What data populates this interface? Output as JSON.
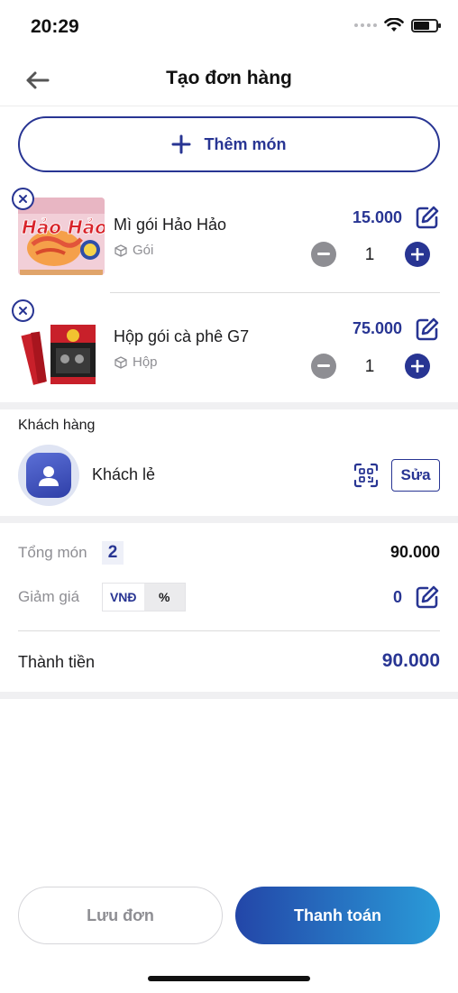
{
  "status_bar": {
    "time": "20:29"
  },
  "header": {
    "title": "Tạo đơn hàng"
  },
  "add_item": {
    "label": "Thêm món"
  },
  "items": [
    {
      "name": "Mì gói Hảo Hảo",
      "unit": "Gói",
      "price": "15.000",
      "quantity": "1",
      "image_text": "Hảo Hảo"
    },
    {
      "name": "Hộp gói cà phê G7",
      "unit": "Hộp",
      "price": "75.000",
      "quantity": "1"
    }
  ],
  "customer": {
    "section_title": "Khách hàng",
    "name": "Khách lẻ",
    "edit_label": "Sửa"
  },
  "summary": {
    "item_count_label": "Tổng món",
    "item_count": "2",
    "item_total": "90.000",
    "discount_label": "Giảm giá",
    "discount_options": [
      "VNĐ",
      "%"
    ],
    "discount_selected": "VNĐ",
    "discount_value": "0",
    "total_label": "Thành tiền",
    "total_value": "90.000"
  },
  "actions": {
    "save_label": "Lưu đơn",
    "pay_label": "Thanh toán"
  },
  "colors": {
    "accent": "#283593",
    "pay_gradient_start": "#2346a8",
    "pay_gradient_end": "#2a9bd8",
    "muted": "#8e8e93"
  }
}
